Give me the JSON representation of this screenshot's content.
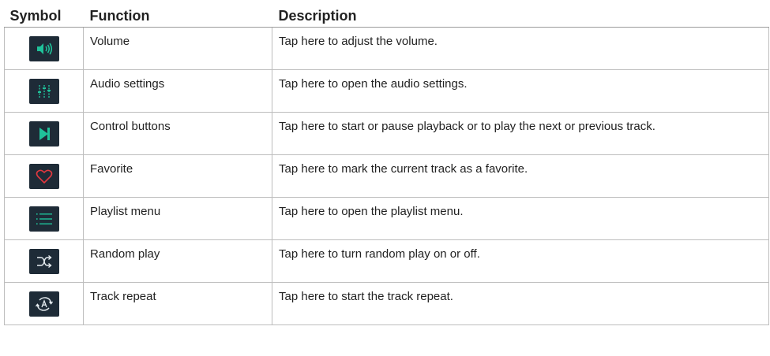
{
  "table": {
    "headers": {
      "symbol": "Symbol",
      "function": "Function",
      "description": "Description"
    },
    "rows": [
      {
        "icon": "volume-icon",
        "function": "Volume",
        "description": "Tap here to adjust the volume."
      },
      {
        "icon": "equalizer-sliders-icon",
        "function": "Audio settings",
        "description": "Tap here to open the audio settings."
      },
      {
        "icon": "skip-next-icon",
        "function": "Control buttons",
        "description": "Tap here to start or pause playback or to play the next or previous track."
      },
      {
        "icon": "heart-icon",
        "function": "Favorite",
        "description": "Tap here to mark the current track as a favorite."
      },
      {
        "icon": "list-icon",
        "function": "Playlist menu",
        "description": "Tap here to open the playlist menu."
      },
      {
        "icon": "shuffle-icon",
        "function": "Random play",
        "description": "Tap here to turn random play on or off."
      },
      {
        "icon": "repeat-a-icon",
        "function": "Track repeat",
        "description": "Tap here to start the track repeat."
      }
    ]
  },
  "colors": {
    "icon_background": "#1e2b37",
    "icon_accent": "#1fc29a",
    "heart": "#e2383f"
  }
}
